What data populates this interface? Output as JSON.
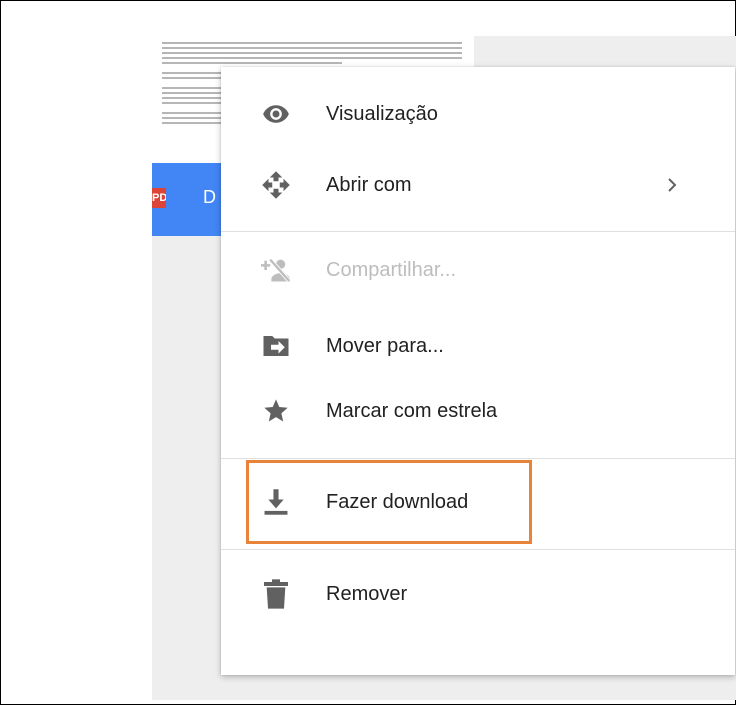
{
  "background_file": {
    "type_badge": "PDF",
    "name_partial": "D"
  },
  "context_menu": {
    "items": [
      {
        "label": "Visualização",
        "icon": "eye-icon"
      },
      {
        "label": "Abrir com",
        "icon": "open-with-icon",
        "has_submenu": true
      },
      {
        "label": "Compartilhar...",
        "icon": "share-person-icon",
        "disabled": true
      },
      {
        "label": "Mover para...",
        "icon": "move-to-folder-icon"
      },
      {
        "label": "Marcar com estrela",
        "icon": "star-icon"
      },
      {
        "label": "Fazer download",
        "icon": "download-icon",
        "highlighted": true
      },
      {
        "label": "Remover",
        "icon": "trash-icon"
      }
    ]
  },
  "colors": {
    "menu_icon": "#616161",
    "disabled": "#bdbdbd",
    "highlight_border": "#e8833a",
    "file_bar": "#4285f4",
    "pdf_badge": "#db4437"
  }
}
